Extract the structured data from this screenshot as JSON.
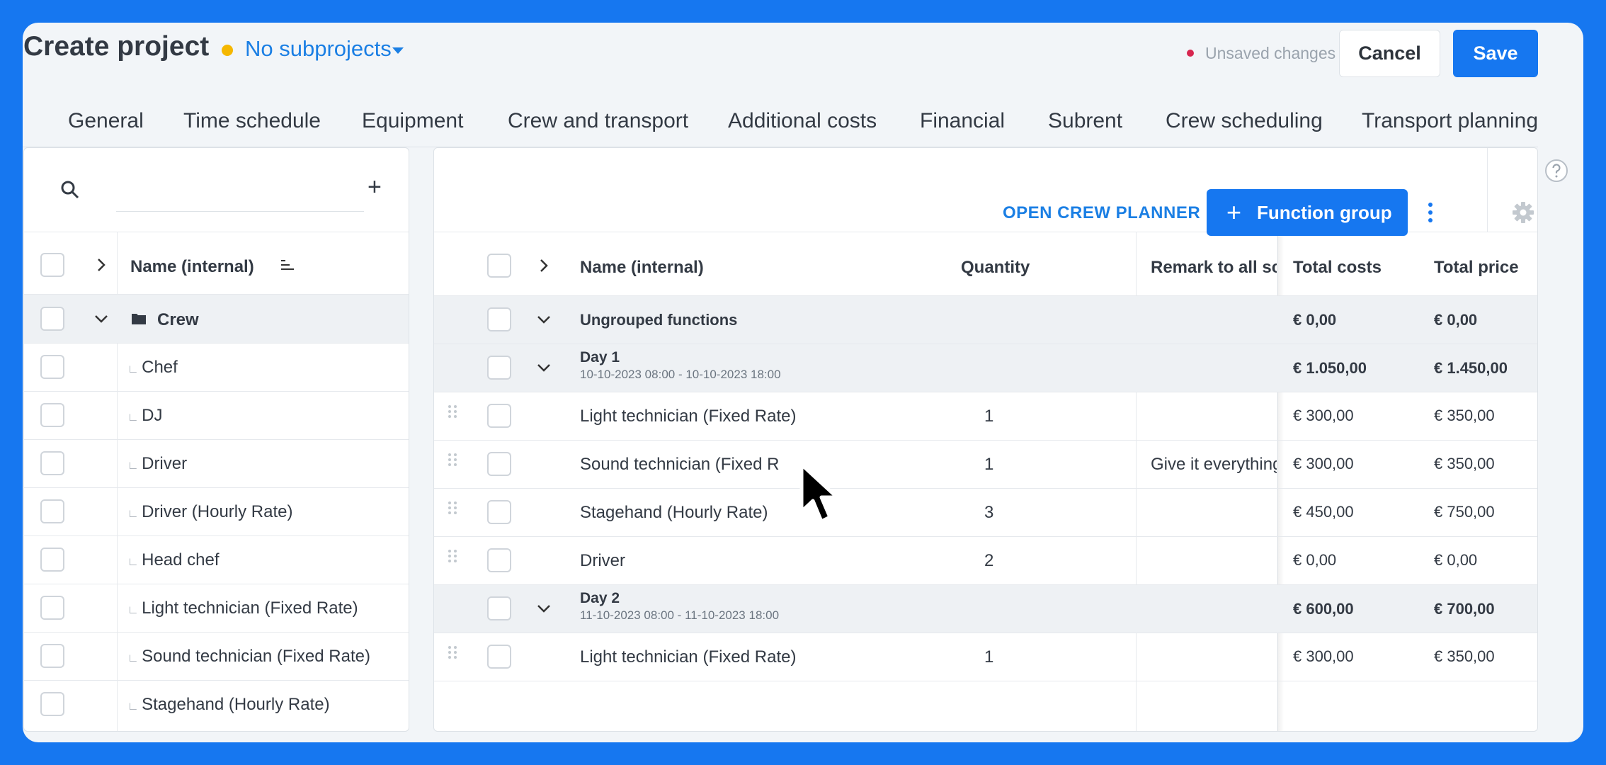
{
  "header": {
    "title": "Create project",
    "subprojects_label": "No subprojects",
    "unsaved_label": "Unsaved changes",
    "cancel_label": "Cancel",
    "save_label": "Save"
  },
  "tabs": [
    {
      "label": "General"
    },
    {
      "label": "Time schedule"
    },
    {
      "label": "Equipment"
    },
    {
      "label": "Crew and transport"
    },
    {
      "label": "Additional costs"
    },
    {
      "label": "Financial"
    },
    {
      "label": "Subrent"
    },
    {
      "label": "Crew scheduling"
    },
    {
      "label": "Transport planning"
    }
  ],
  "left_panel": {
    "search_placeholder": "",
    "column_name": "Name (internal)",
    "group": "Crew",
    "items": [
      "Chef",
      "DJ",
      "Driver",
      "Driver (Hourly Rate)",
      "Head chef",
      "Light technician (Fixed Rate)",
      "Sound technician (Fixed Rate)",
      "Stagehand (Hourly Rate)"
    ]
  },
  "right_panel": {
    "open_planner_label": "OPEN CREW PLANNER",
    "function_group_label": "Function group",
    "columns": {
      "name": "Name (internal)",
      "quantity": "Quantity",
      "remark": "Remark to all sch",
      "total_costs": "Total costs",
      "total_price": "Total price"
    },
    "ungrouped": {
      "label": "Ungrouped functions",
      "costs": "€ 0,00",
      "price": "€ 0,00"
    },
    "day1": {
      "label": "Day 1",
      "range": "10-10-2023 08:00 - 10-10-2023 18:00",
      "costs": "€ 1.050,00",
      "price": "€ 1.450,00"
    },
    "day1_rows": [
      {
        "name": "Light technician (Fixed Rate)",
        "qty": "1",
        "remark": "",
        "costs": "€ 300,00",
        "price": "€ 350,00"
      },
      {
        "name": "Sound technician (Fixed R",
        "qty": "1",
        "remark": "Give it everything",
        "costs": "€ 300,00",
        "price": "€ 350,00"
      },
      {
        "name": "Stagehand (Hourly Rate)",
        "qty": "3",
        "remark": "",
        "costs": "€ 450,00",
        "price": "€ 750,00"
      },
      {
        "name": "Driver",
        "qty": "2",
        "remark": "",
        "costs": "€ 0,00",
        "price": "€ 0,00"
      }
    ],
    "day2": {
      "label": "Day 2",
      "range": "11-10-2023 08:00 - 11-10-2023 18:00",
      "costs": "€ 600,00",
      "price": "€ 700,00"
    },
    "day2_rows": [
      {
        "name": "Light technician (Fixed Rate)",
        "qty": "1",
        "remark": "",
        "costs": "€ 300,00",
        "price": "€ 350,00"
      }
    ]
  },
  "colors": {
    "accent": "#1677f0",
    "status_dot": "#f5b700",
    "unsaved_dot": "#d7264f"
  }
}
